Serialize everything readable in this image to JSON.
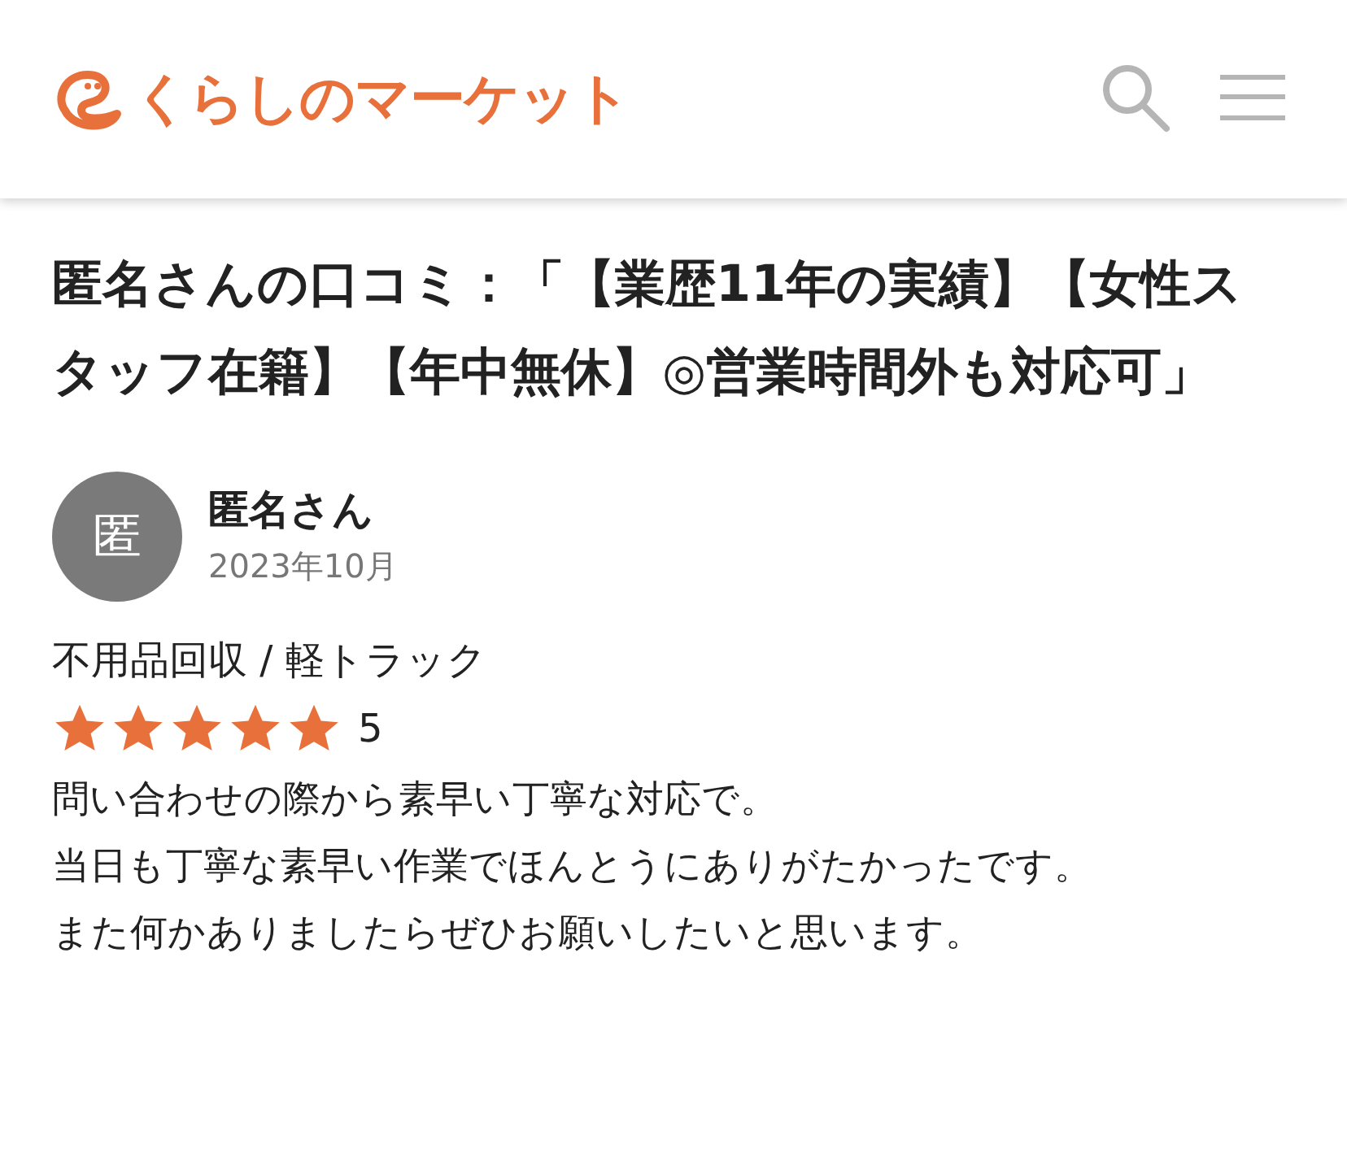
{
  "header": {
    "logo_text": "くらしのマーケット"
  },
  "title": "匿名さんの口コミ：「【業歴11年の実績】【女性スタッフ在籍】【年中無休】◎営業時間外も対応可」",
  "review": {
    "avatar": "匿",
    "name": "匿名さん",
    "date": "2023年10月",
    "category": "不用品回収 / 軽トラック",
    "stars": 5,
    "score": "5",
    "body": [
      "問い合わせの際から素早い丁寧な対応で。",
      "当日も丁寧な素早い作業でほんとうにありがたかったです。",
      "また何かありましたらぜひお願いしたいと思います。"
    ]
  }
}
